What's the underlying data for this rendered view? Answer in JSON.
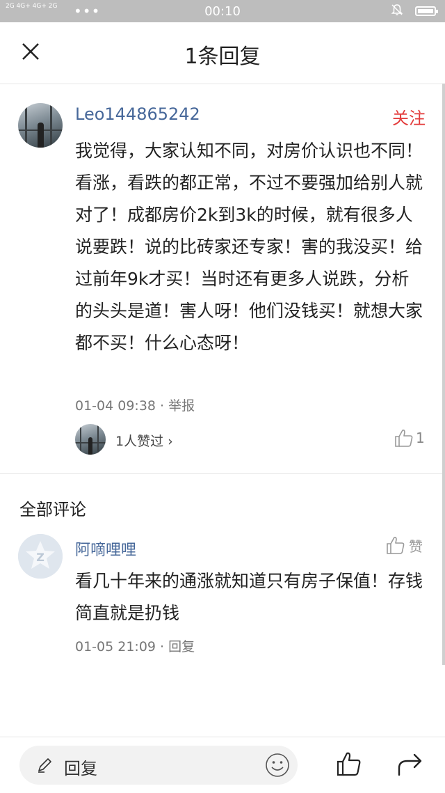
{
  "status_bar": {
    "signal_text": "2G 4G+ 4G+ 2G",
    "dots": "•••",
    "time": "00:10"
  },
  "header": {
    "title": "1条回复"
  },
  "main_comment": {
    "username": "Leo144865242",
    "follow_label": "关注",
    "text": "我觉得，大家认知不同，对房价认识也不同！看涨，看跌的都正常，不过不要强加给别人就对了！成都房价2k到3k的时候，就有很多人说要跌！说的比砖家还专家！害的我没买！给过前年9k才买！当时还有更多人说跌，分析的头头是道！害人呀！他们没钱买！就想大家都不买！什么心态呀！",
    "time": "01-04 09:38",
    "separator": " · ",
    "report_label": "举报",
    "likes_text": "1人赞过 ›",
    "like_count": "1"
  },
  "section": {
    "title": "全部评论"
  },
  "reply": {
    "username": "阿嘀哩哩",
    "like_label": "赞",
    "text": "看几十年来的通涨就知道只有房子保值！存钱简直就是扔钱",
    "time": "01-05 21:09",
    "separator": " · ",
    "reply_label": "回复"
  },
  "bottom_bar": {
    "input_placeholder": "回复"
  },
  "colors": {
    "link_blue": "#47689a",
    "follow_red": "#e33b3b",
    "status_bar_bg": "#bdbdbd"
  },
  "icons": {
    "close": "close-icon",
    "thumb": "thumbs-up-icon",
    "pen": "pen-icon",
    "emoji": "emoji-icon",
    "share": "share-icon",
    "bell": "bell-muted-icon",
    "battery": "battery-icon"
  }
}
